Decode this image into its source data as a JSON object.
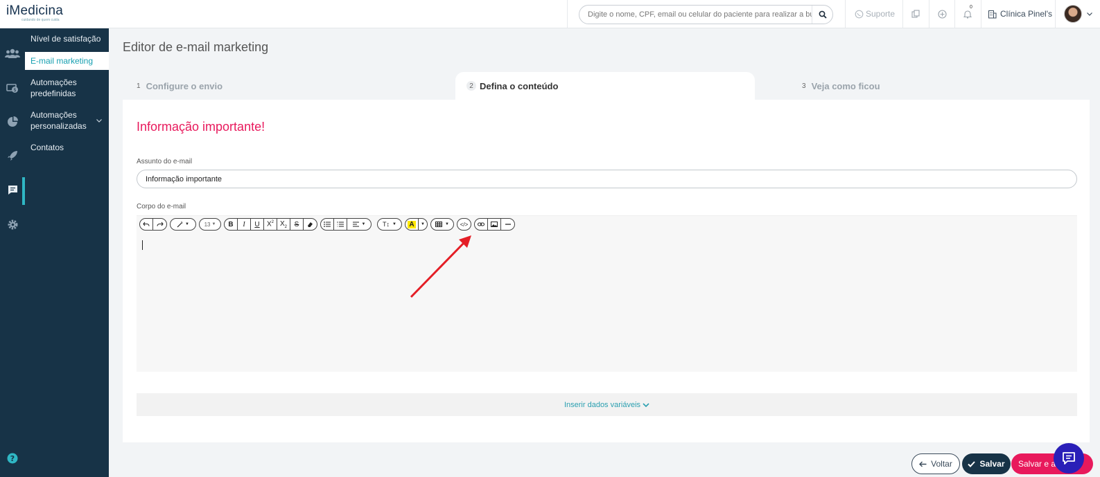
{
  "header": {
    "logo": "iMedicina",
    "logo_tagline": "cuidando de quem cuida",
    "search_placeholder": "Digite o nome, CPF, email ou celular do paciente para realizar a busca",
    "support_label": "Suporte",
    "notification_count": "0",
    "clinic_name": "Clínica Pinel's"
  },
  "subnav": {
    "items": [
      {
        "label": "Nível de satisfação"
      },
      {
        "label": "E-mail marketing"
      },
      {
        "label": "Automações predefinidas"
      },
      {
        "label": "Automações personalizadas"
      },
      {
        "label": "Contatos"
      }
    ]
  },
  "page": {
    "title": "Editor de e-mail marketing"
  },
  "steps": [
    {
      "num": "1",
      "label": "Configure o envio"
    },
    {
      "num": "2",
      "label": "Defina o conteúdo"
    },
    {
      "num": "3",
      "label": "Veja como ficou"
    }
  ],
  "card": {
    "title": "Informação importante!",
    "subject_label": "Assunto do e-mail",
    "subject_value": "Informação importante",
    "body_label": "Corpo do e-mail",
    "insert_label": "Inserir dados variáveis"
  },
  "toolbar": {
    "font_size": "13"
  },
  "buttons": {
    "back": "Voltar",
    "save": "Salvar",
    "save_next": "Salvar e avançar"
  },
  "colors": {
    "sidebar": "#173347",
    "accent": "#e8195c",
    "teal": "#2fb7c4",
    "chat": "#2a1fb8"
  }
}
